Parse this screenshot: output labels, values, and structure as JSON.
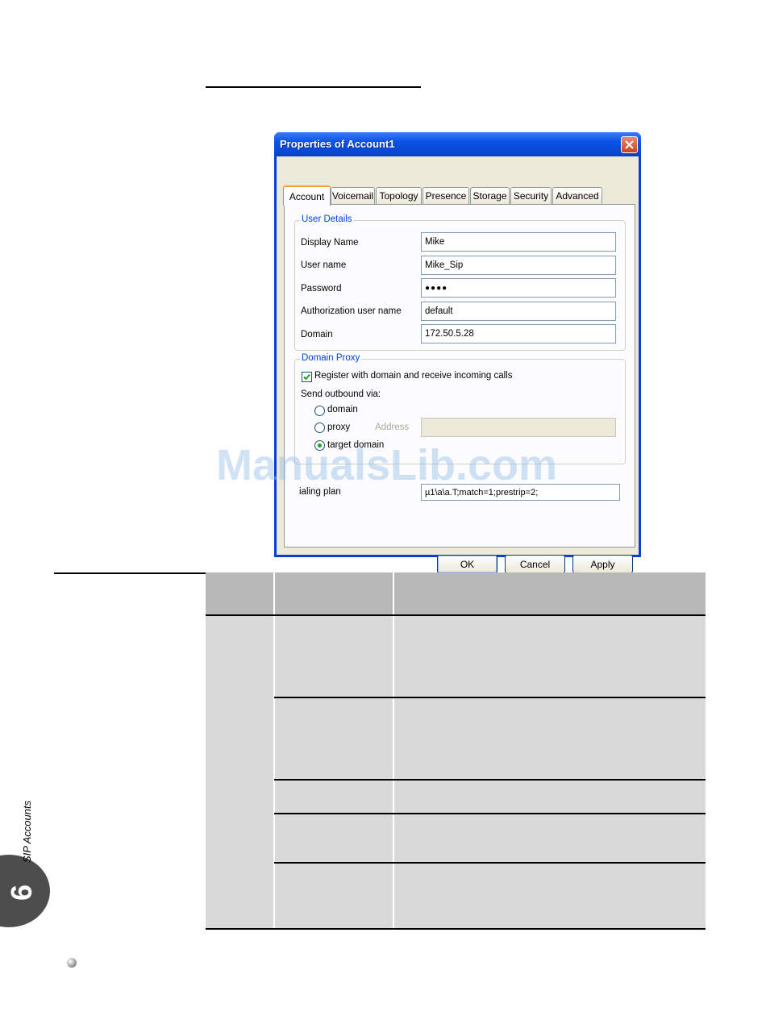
{
  "dialog": {
    "title": "Properties of Account1",
    "tabs": [
      "Account",
      "Voicemail",
      "Topology",
      "Presence",
      "Storage",
      "Security",
      "Advanced"
    ],
    "active_tab": "Account",
    "user_details": {
      "group_label": "User Details",
      "display_name_label": "Display Name",
      "display_name_value": "Mike",
      "user_name_label": "User name",
      "user_name_value": "Mike_Sip",
      "password_label": "Password",
      "password_value": "●●●●",
      "auth_user_label": "Authorization user name",
      "auth_user_value": "default",
      "domain_label": "Domain",
      "domain_value": "172.50.5.28"
    },
    "domain_proxy": {
      "group_label": "Domain Proxy",
      "register_label": "Register with domain and receive incoming calls",
      "register_checked": true,
      "send_outbound_label": "Send outbound via:",
      "opt_domain": "domain",
      "opt_proxy": "proxy",
      "address_label": "Address",
      "opt_target": "target domain",
      "selected": "target domain"
    },
    "dial_plan_label": "ialing plan",
    "dial_plan_value": "µ1\\a\\a.T;match=1;prestrip=2;",
    "buttons": {
      "ok": "OK",
      "cancel": "Cancel",
      "apply": "Apply"
    }
  },
  "watermark": "ManualsLib.com",
  "side_tab": {
    "chapter": "6",
    "title": "SIP Accounts"
  }
}
